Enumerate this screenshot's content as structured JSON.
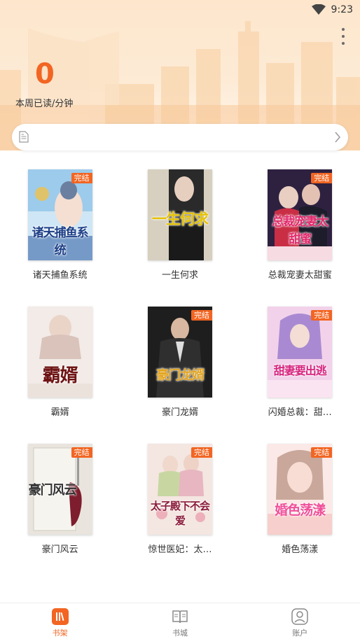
{
  "status_bar": {
    "time": "9:23"
  },
  "header": {
    "read_count": "0",
    "read_label": "本周已读/分钟"
  },
  "books": [
    {
      "title": "诸天捕鱼系统",
      "cover_title": "诸天捕鱼系统",
      "badge": "完结",
      "palette": [
        "#8bc3e8",
        "#c9e3f5",
        "#2a4f8a"
      ]
    },
    {
      "title": "一生何求",
      "cover_title": "一生何求",
      "badge": "",
      "palette": [
        "#d9d2c3",
        "#1f1f1f",
        "#c9a800"
      ]
    },
    {
      "title": "总裁宠妻太甜蜜",
      "cover_title": "总裁宠妻太甜蜜",
      "badge": "完结",
      "palette": [
        "#2b1e3e",
        "#c2314a",
        "#e03a73"
      ]
    },
    {
      "title": "霸婿",
      "cover_title": "霸婿",
      "badge": "",
      "palette": [
        "#f3ece9",
        "#d9c8c2",
        "#7a1d1d"
      ]
    },
    {
      "title": "豪门龙婿",
      "cover_title": "豪门龙婿",
      "badge": "完结",
      "palette": [
        "#1b1b1b",
        "#3d3d3d",
        "#e0a020"
      ]
    },
    {
      "title": "闪婚总裁：甜…",
      "cover_title": "甜妻要出逃",
      "badge": "完结",
      "palette": [
        "#f4d6ec",
        "#c79ad8",
        "#d02a8a"
      ]
    },
    {
      "title": "豪门风云",
      "cover_title": "豪门风云",
      "badge": "完结",
      "palette": [
        "#e8e4dc",
        "#8a2332",
        "#3b3b3b"
      ]
    },
    {
      "title": "惊世医妃：太…",
      "cover_title": "太子殿下不会爱",
      "badge": "完结",
      "palette": [
        "#f3e2dd",
        "#c3465a",
        "#8a1c3a"
      ]
    },
    {
      "title": "婚色荡漾",
      "cover_title": "婚色荡漾",
      "badge": "完结",
      "palette": [
        "#fbe7e6",
        "#f5c4c0",
        "#e8508a"
      ]
    }
  ],
  "nav": [
    {
      "label": "书架",
      "icon": "bookshelf-icon",
      "active": true
    },
    {
      "label": "书城",
      "icon": "book-store-icon",
      "active": false
    },
    {
      "label": "账户",
      "icon": "account-icon",
      "active": false
    }
  ],
  "colors": {
    "accent": "#f26522",
    "header_bg": "#fde6cc"
  }
}
